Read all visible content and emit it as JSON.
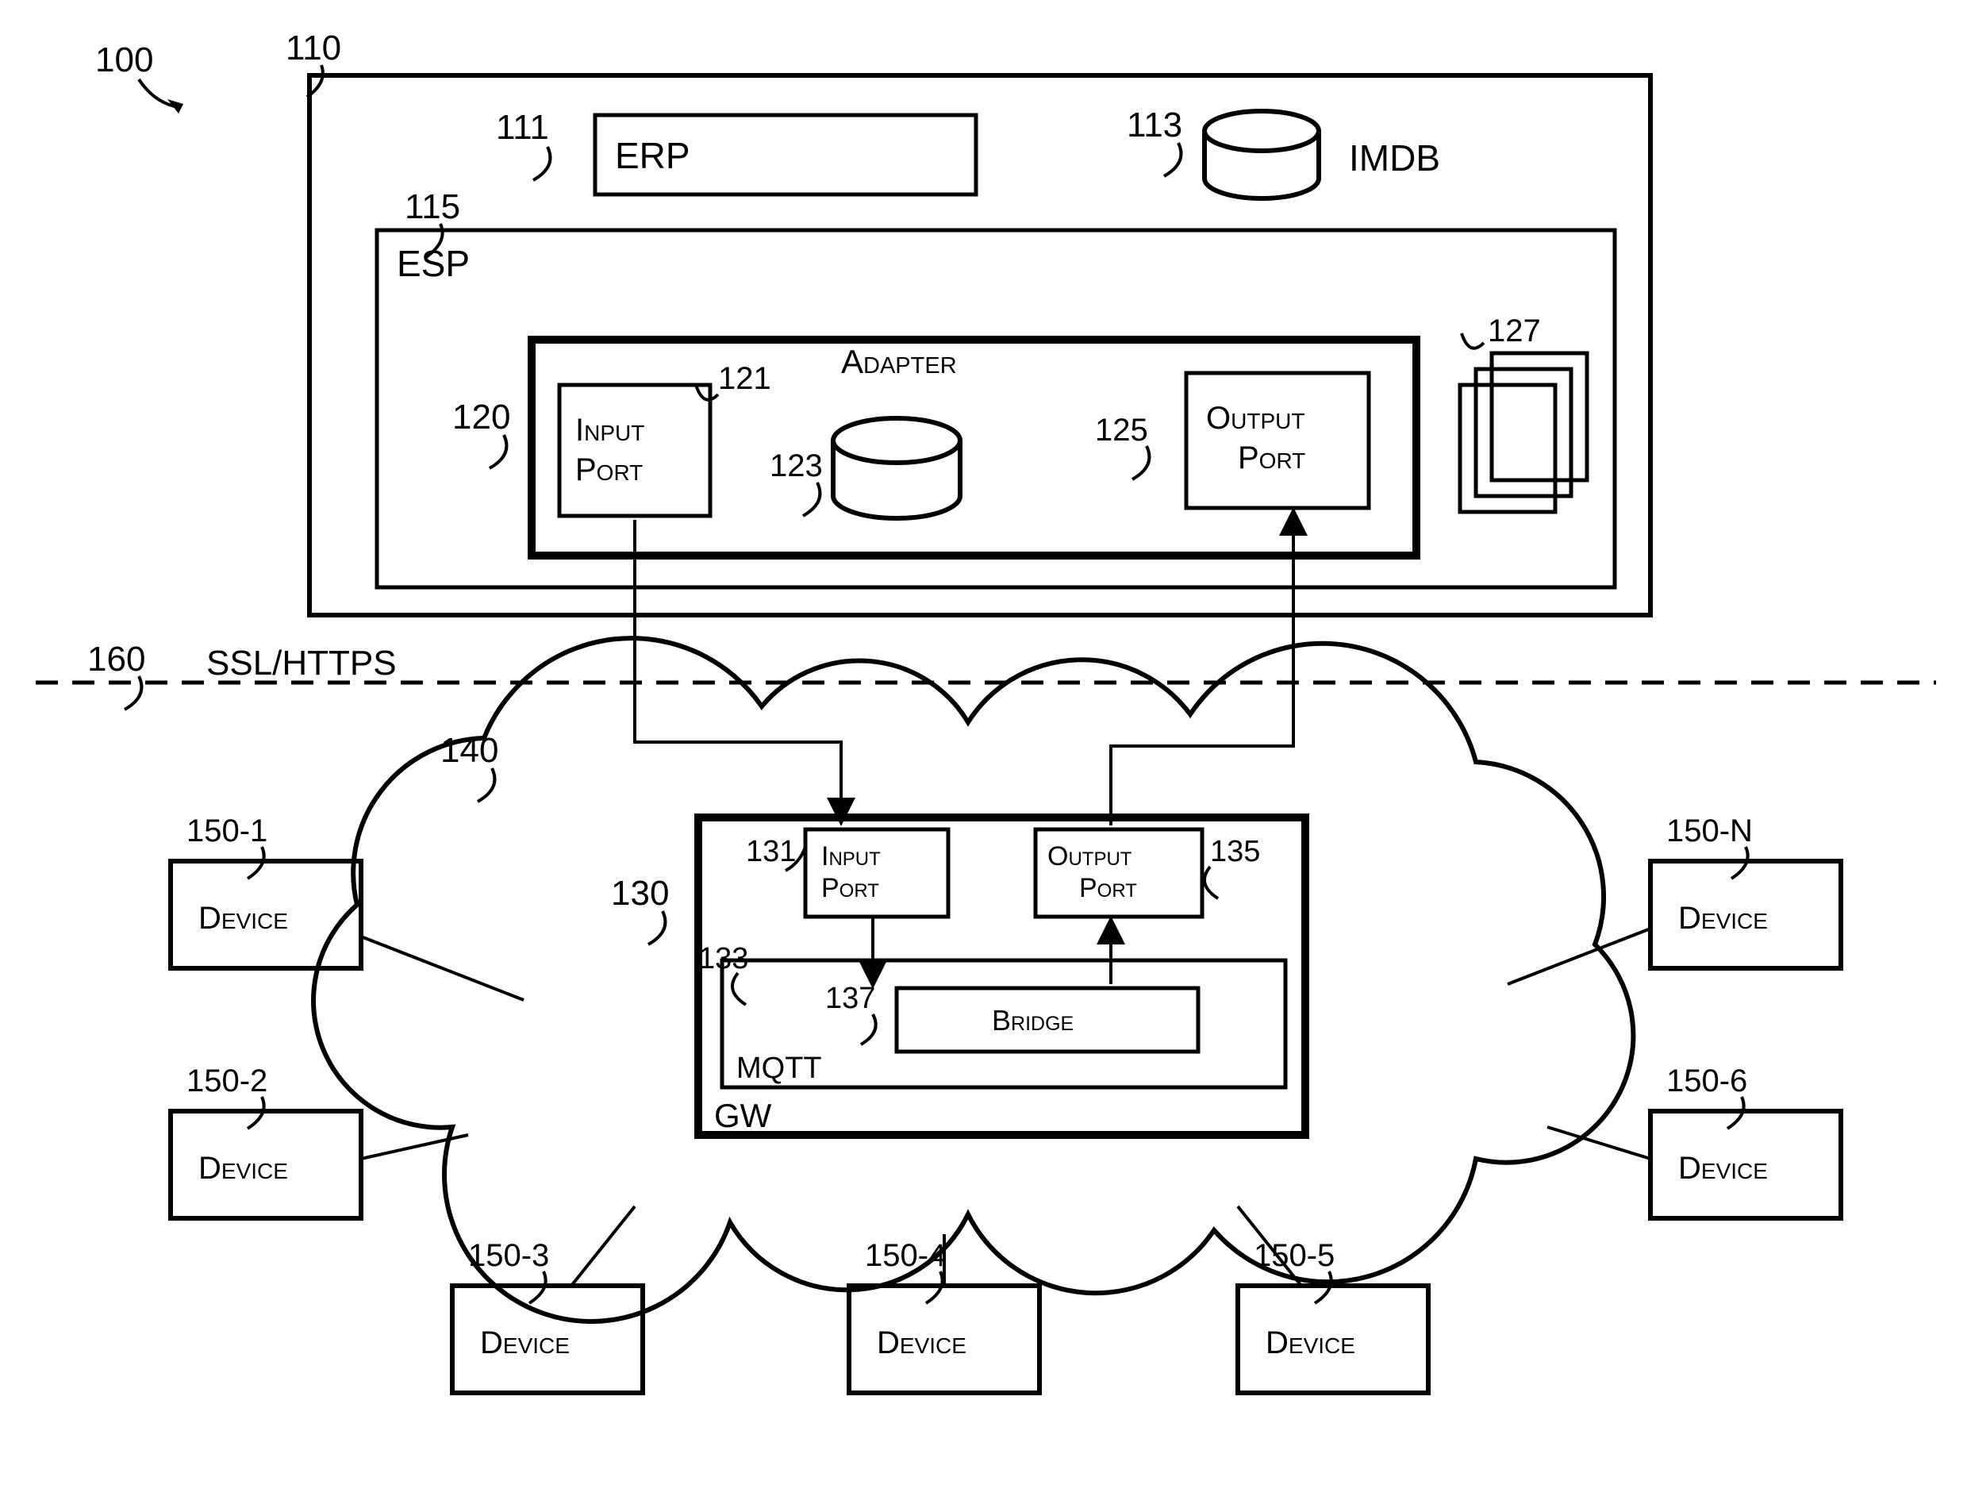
{
  "figure": {
    "ref_main": "100",
    "ssl_line": {
      "ref": "160",
      "label": "SSL/HTTPS"
    },
    "top_container": {
      "ref": "110",
      "erp": {
        "ref": "111",
        "label": "ERP"
      },
      "imdb": {
        "ref": "113",
        "label": "IMDB"
      },
      "esp": {
        "ref": "115",
        "label": "ESP",
        "adapter_block": {
          "ref": "120",
          "adapter_label": "Adapter",
          "input_port": {
            "ref": "121",
            "label_l1": "Input",
            "label_l2": "Port"
          },
          "adapter_cyl": {
            "ref": "123"
          },
          "output_port": {
            "ref": "125",
            "label_l1": "Output",
            "label_l2": "Port"
          },
          "out_stack": {
            "ref": "127"
          }
        }
      }
    },
    "cloud": {
      "ref": "140"
    },
    "gateway": {
      "ref": "130",
      "label": "GW",
      "input_port": {
        "ref": "131",
        "label_l1": "Input",
        "label_l2": "Port"
      },
      "output_port": {
        "ref": "135",
        "label_l1": "Output",
        "label_l2": "Port"
      },
      "mqtt": {
        "ref": "133",
        "label": "MQTT"
      },
      "bridge": {
        "ref": "137",
        "label": "Bridge"
      }
    },
    "devices": [
      {
        "ref": "150-1",
        "label": "Device"
      },
      {
        "ref": "150-2",
        "label": "Device"
      },
      {
        "ref": "150-3",
        "label": "Device"
      },
      {
        "ref": "150-4",
        "label": "Device"
      },
      {
        "ref": "150-5",
        "label": "Device"
      },
      {
        "ref": "150-6",
        "label": "Device"
      },
      {
        "ref": "150-N",
        "label": "Device"
      }
    ]
  }
}
